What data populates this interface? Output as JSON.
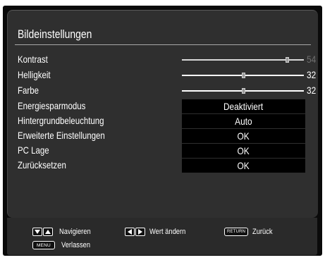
{
  "menu": {
    "title": "Bildeinstellungen",
    "sliders": [
      {
        "label": "Kontrast",
        "value": "54",
        "level": 0.86,
        "dimmed": true
      },
      {
        "label": "Helligkeit",
        "value": "32",
        "level": 0.5,
        "dimmed": false
      },
      {
        "label": "Farbe",
        "value": "32",
        "level": 0.5,
        "dimmed": false
      }
    ],
    "options": [
      {
        "label": "Energiesparmodus",
        "value": "Deaktiviert"
      },
      {
        "label": "Hintergrundbeleuchtung",
        "value": "Auto"
      },
      {
        "label": "Erweiterte Einstellungen",
        "value": "OK"
      },
      {
        "label": "PC Lage",
        "value": "OK"
      },
      {
        "label": "Zurücksetzen",
        "value": "OK"
      }
    ]
  },
  "footer": {
    "navigate": "Navigieren",
    "change_value": "Wert ändern",
    "return_key": "RETURN",
    "back": "Zurück",
    "menu_key": "MENU",
    "exit": "Verlassen"
  },
  "colors": {
    "menu_bg": "#2f2f2f",
    "value_box_bg": "#000000",
    "text": "#ffffff",
    "dim_value": "#6f6f6f"
  }
}
